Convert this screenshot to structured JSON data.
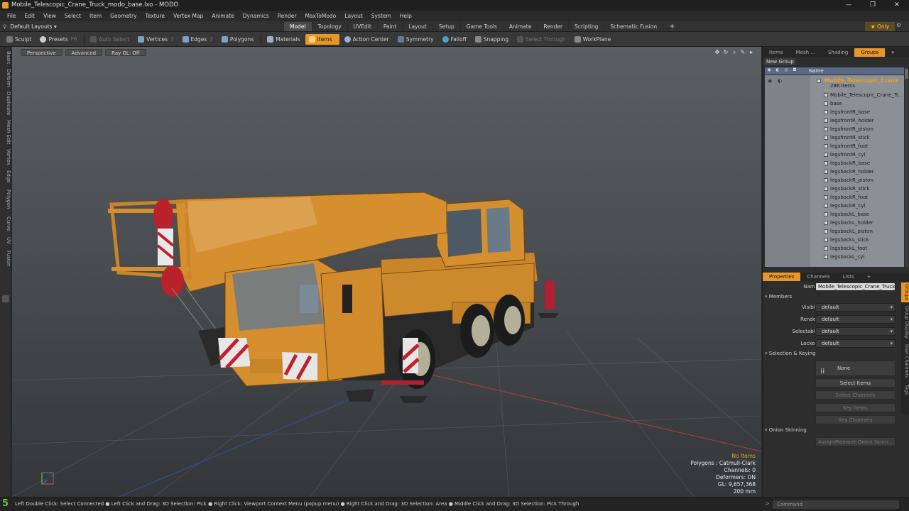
{
  "window": {
    "title": "Mobile_Telescopic_Crane_Truck_modo_base.lxo - MODO"
  },
  "menu": [
    "File",
    "Edit",
    "View",
    "Select",
    "Item",
    "Geometry",
    "Texture",
    "Vertex Map",
    "Animate",
    "Dynamics",
    "Render",
    "MaxToModo",
    "Layout",
    "System",
    "Help"
  ],
  "layout_selector": "Default Layouts",
  "tabs": [
    "Model",
    "Topology",
    "UVEdit",
    "Paint",
    "Layout",
    "Setup",
    "Game Tools",
    "Animate",
    "Render",
    "Scripting",
    "Schematic Fusion"
  ],
  "only_label": "Only",
  "toolbar": {
    "sculpt": "Sculpt",
    "presets": "Presets",
    "presets_key": "F6",
    "auto_select": "Auto Select",
    "vertices": "Vertices",
    "vertices_key": "1",
    "edges": "Edges",
    "edges_key": "2",
    "polygons": "Polygons",
    "materials": "Materials",
    "items": "Items",
    "action_center": "Action Center",
    "symmetry": "Symmetry",
    "falloff": "Falloff",
    "snapping": "Snapping",
    "select_through": "Select Through",
    "workplane": "WorkPlane"
  },
  "left_tabs": [
    "Basic",
    "Deform",
    "Duplicate",
    "Mesh Edit",
    "Vertex",
    "Edge",
    "Polygon",
    "Curve",
    "UV",
    "Fusion"
  ],
  "viewport": {
    "buttons": [
      "Perspective",
      "Advanced",
      "Ray GL: Off"
    ],
    "info": {
      "no_items": "No Items",
      "polygons": "Polygons : Catmull-Clark",
      "channels": "Channels: 0",
      "deformers": "Deformers: ON",
      "gl": "GL: 9,657,368",
      "scale": "200 mm"
    }
  },
  "items_panel": {
    "tabs": [
      "Items",
      "Mesh ...",
      "Shading",
      "Groups"
    ],
    "new_group": "New Group",
    "name_header": "Name",
    "group_name": "Mobile_Telescopic_Crane ...",
    "group_count": "286 Items",
    "rows": [
      "Mobile_Telescopic_Crane_Tr...",
      "base",
      "legsfrontR_base",
      "legsfrontR_holder",
      "legsfrontR_piston",
      "legsfrontR_stick",
      "legsfrontR_foot",
      "legsfrontR_cyl",
      "legsbackR_base",
      "legsbackR_holder",
      "legsbackR_piston",
      "legsbackR_stick",
      "legsbackR_foot",
      "legsbackR_cyl",
      "legsbackL_base",
      "legsbackL_holder",
      "legsbackL_piston",
      "legsbackL_stick",
      "legsbackL_foot",
      "legsbackL_cyl"
    ]
  },
  "properties": {
    "tabs": [
      "Properties",
      "Channels",
      "Lists"
    ],
    "name_label": "Name",
    "name_value": "Mobile_Telescopic_Crane_Truck (",
    "members_label": "Members",
    "visible_label": "Visible",
    "visible_value": "default",
    "render_label": "Render",
    "render_value": "default",
    "selectable_label": "Selectable",
    "selectable_value": "default",
    "locked_label": "Locked",
    "locked_value": "default",
    "selection_keying": "Selection & Keying",
    "none_label": "None",
    "select_items": "Select Items",
    "select_channels": "Select Channels",
    "key_items": "Key Items",
    "key_channels": "Key Channels",
    "onion_skinning": "Onion Skinning",
    "assign_onion": "Assign/Remove Onion Skinn...",
    "side_tabs": [
      "Groups",
      "Group Display",
      "User Channels",
      "Tags"
    ]
  },
  "status": {
    "layout_num": "5",
    "hint": "Left Double Click: Select Connected ● Left Click and Drag: 3D Selection: Pick ● Right Click: Viewport Context Menu (popup menu) ● Right Click and Drag: 3D Selection: Area ● Middle Click and Drag: 3D Selection: Pick Through",
    "command_placeholder": "Command"
  },
  "colors": {
    "accent": "#e8962a",
    "crane_body": "#d68f2e",
    "group_name": "#f0a020",
    "status_green": "#6ac43e"
  }
}
